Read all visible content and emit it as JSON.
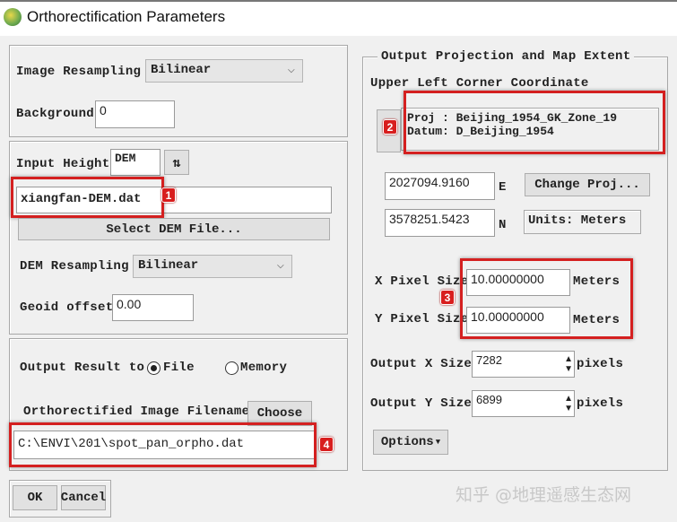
{
  "window": {
    "title": "Orthorectification Parameters"
  },
  "left": {
    "image_resampling_label": "Image Resampling",
    "image_resampling_value": "Bilinear",
    "background_label": "Background",
    "background_value": "0",
    "input_height_label": "Input Height",
    "input_height_value": "DEM",
    "dem_file_value": "xiangfan-DEM.dat",
    "select_dem_label": "Select DEM File...",
    "dem_resampling_label": "DEM Resampling",
    "dem_resampling_value": "Bilinear",
    "geoid_label": "Geoid offset",
    "geoid_value": "0.00",
    "output_result_label": "Output Result to",
    "radio_file": "File",
    "radio_memory": "Memory",
    "output_selected": "File",
    "filename_label": "Orthorectified Image Filename",
    "choose_label": "Choose",
    "filename_value": "C:\\ENVI\\201\\spot_pan_orpho.dat",
    "ok_label": "OK",
    "cancel_label": "Cancel"
  },
  "right": {
    "group_title": "Output Projection and Map Extent",
    "ulc_label": "Upper Left Corner Coordinate",
    "proj_line": "Proj : Beijing_1954_GK_Zone_19",
    "datum_line": "Datum: D_Beijing_1954",
    "easting": "2027094.9160",
    "e_label": "E",
    "northing": "3578251.5423",
    "n_label": "N",
    "change_proj_label": "Change Proj...",
    "units_label": "Units: Meters",
    "x_pixel_label": "X Pixel Size",
    "x_pixel_value": "10.00000000",
    "x_unit": "Meters",
    "y_pixel_label": "Y Pixel Size",
    "y_pixel_value": "10.00000000",
    "y_unit": "Meters",
    "out_x_label": "Output X Size",
    "out_x_value": "7282",
    "out_x_unit": "pixels",
    "out_y_label": "Output Y Size",
    "out_y_value": "6899",
    "out_y_unit": "pixels",
    "options_label": "Options"
  },
  "badges": [
    "1",
    "2",
    "3",
    "4"
  ],
  "watermark": "知乎 @地理遥感生态网",
  "colors": {
    "highlight": "#d42020"
  }
}
